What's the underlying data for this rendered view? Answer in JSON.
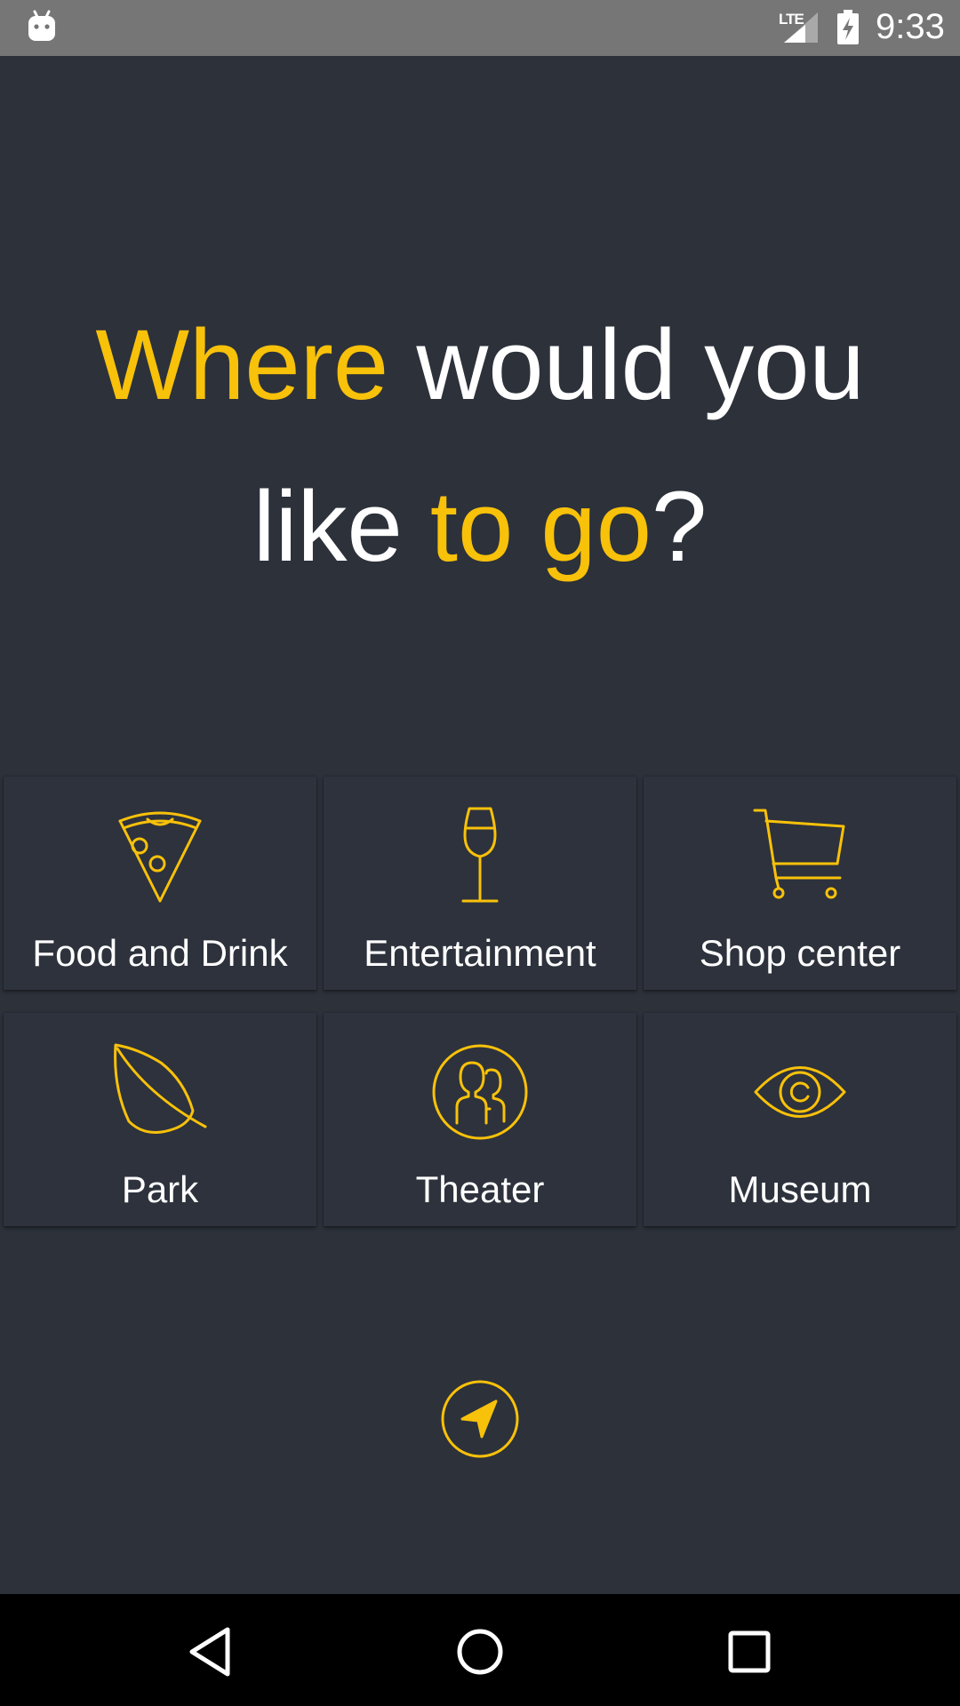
{
  "status_bar": {
    "network": "LTE",
    "time": "9:33",
    "icons": [
      "android-robot-icon",
      "signal-icon",
      "battery-charging-icon"
    ]
  },
  "headline": {
    "line1": {
      "accent": "Where",
      "rest": " would you"
    },
    "line2": {
      "start": "like ",
      "accent": "to go",
      "end": "?"
    }
  },
  "categories": [
    {
      "label": "Food and Drink",
      "icon": "pizza-icon"
    },
    {
      "label": "Entertainment",
      "icon": "wine-glass-icon"
    },
    {
      "label": "Shop center",
      "icon": "shopping-cart-icon"
    },
    {
      "label": "Park",
      "icon": "leaf-icon"
    },
    {
      "label": "Theater",
      "icon": "people-icon"
    },
    {
      "label": "Museum",
      "icon": "eye-icon"
    }
  ],
  "locate": {
    "icon": "navigation-arrow-icon"
  },
  "nav_bar": {
    "icons": [
      "back-icon",
      "home-icon",
      "recents-icon"
    ]
  },
  "colors": {
    "accent": "#f8c10a",
    "background": "#2c313a",
    "tile": "#2d323c",
    "status_bar": "#767676",
    "nav_bar": "#000000"
  }
}
